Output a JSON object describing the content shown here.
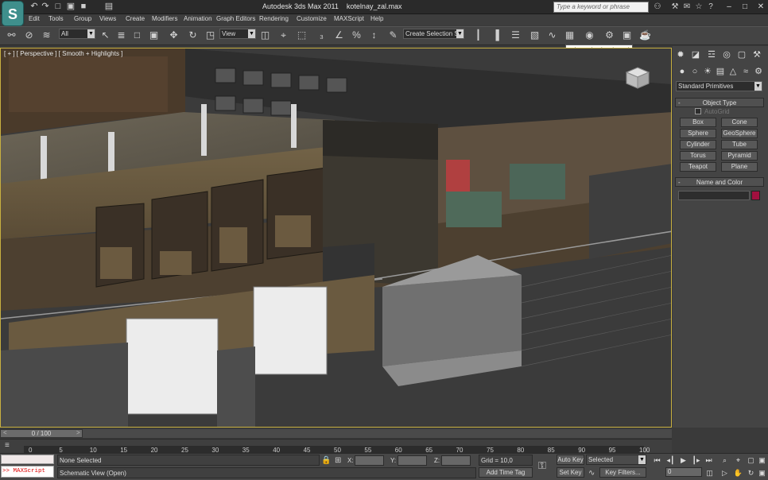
{
  "title": {
    "logo": "S",
    "app": "Autodesk 3ds Max  2011",
    "file": "kotelnay_zal.max",
    "search_placeholder": "Type a keyword or phrase",
    "quick_access_icons": [
      "undo-icon",
      "redo-icon",
      "new-file-icon",
      "open-icon",
      "save-icon"
    ]
  },
  "menu": [
    "Edit",
    "Tools",
    "Group",
    "Views",
    "Create",
    "Modifiers",
    "Animation",
    "Graph Editors",
    "Rendering",
    "Customize",
    "MAXScript",
    "Help"
  ],
  "toolbar": {
    "selection_filter": "All",
    "reference_coord": "View",
    "named_selection": "Create Selection Se"
  },
  "tooltip": "Schematic View (Open)",
  "viewport": {
    "label": "[ + ] [ Perspective ] [ Smooth + Highlights ]"
  },
  "command_panel": {
    "dropdown": "Standard Primitives",
    "object_type": {
      "title": "Object Type",
      "autogrid": "AutoGrid",
      "buttons": [
        "Box",
        "Cone",
        "Sphere",
        "GeoSphere",
        "Cylinder",
        "Tube",
        "Torus",
        "Pyramid",
        "Teapot",
        "Plane"
      ]
    },
    "name_color": {
      "title": "Name and Color",
      "swatch_color": "#a1103f"
    },
    "rollout_sign": "-"
  },
  "timeline": {
    "slider_label": "0 / 100",
    "ticks": [
      "0",
      "5",
      "10",
      "15",
      "20",
      "25",
      "30",
      "35",
      "40",
      "45",
      "50",
      "55",
      "60",
      "65",
      "70",
      "75",
      "80",
      "85",
      "90",
      "95",
      "100"
    ]
  },
  "status": {
    "maxscript_label": ">> MAXScript",
    "none_selected": "None Selected",
    "prompt": "Schematic View (Open)",
    "x_label": "X:",
    "y_label": "Y:",
    "z_label": "Z:",
    "grid": "Grid = 10,0",
    "add_time_tag": "Add Time Tag",
    "auto_key": "Auto Key",
    "set_key": "Set Key",
    "selected": "Selected",
    "key_filters": "Key Filters...",
    "frame": "0"
  }
}
